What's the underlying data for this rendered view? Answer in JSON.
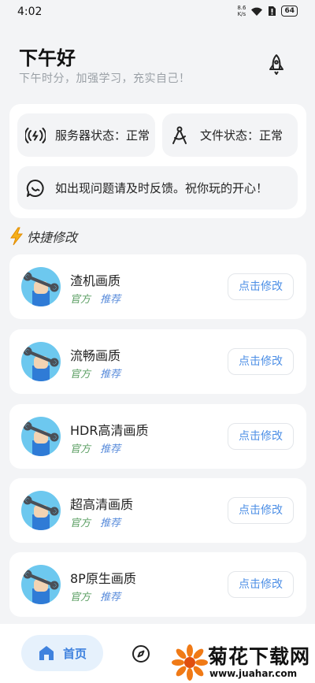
{
  "status_bar": {
    "time": "4:02",
    "net_speed_value": "8.6",
    "net_speed_unit": "K/s",
    "battery": "64"
  },
  "header": {
    "greeting": "下午好",
    "subtitle": "下午时分，加强学习，充实自己！",
    "rocket_icon": "rocket-icon"
  },
  "status": {
    "server_label": "服务器状态：正常",
    "file_label": "文件状态：正常",
    "notice": "如出现问题请及时反馈。祝你玩的开心！"
  },
  "quick_edit": {
    "title": "快捷修改",
    "items": [
      {
        "title": "渣机画质",
        "tag_official": "官方",
        "tag_recommend": "推荐",
        "button": "点击修改"
      },
      {
        "title": "流畅画质",
        "tag_official": "官方",
        "tag_recommend": "推荐",
        "button": "点击修改"
      },
      {
        "title": "HDR高清画质",
        "tag_official": "官方",
        "tag_recommend": "推荐",
        "button": "点击修改"
      },
      {
        "title": "超高清画质",
        "tag_official": "官方",
        "tag_recommend": "推荐",
        "button": "点击修改"
      },
      {
        "title": "8P原生画质",
        "tag_official": "官方",
        "tag_recommend": "推荐",
        "button": "点击修改"
      }
    ]
  },
  "nav": {
    "home_label": "首页"
  },
  "watermark": {
    "name": "菊花下载网",
    "url": "www.juahar.com"
  },
  "colors": {
    "accent": "#3f82de",
    "official_tag": "#5a9e62",
    "recommend_tag": "#5b8ddb",
    "background": "#f3f4f6"
  }
}
